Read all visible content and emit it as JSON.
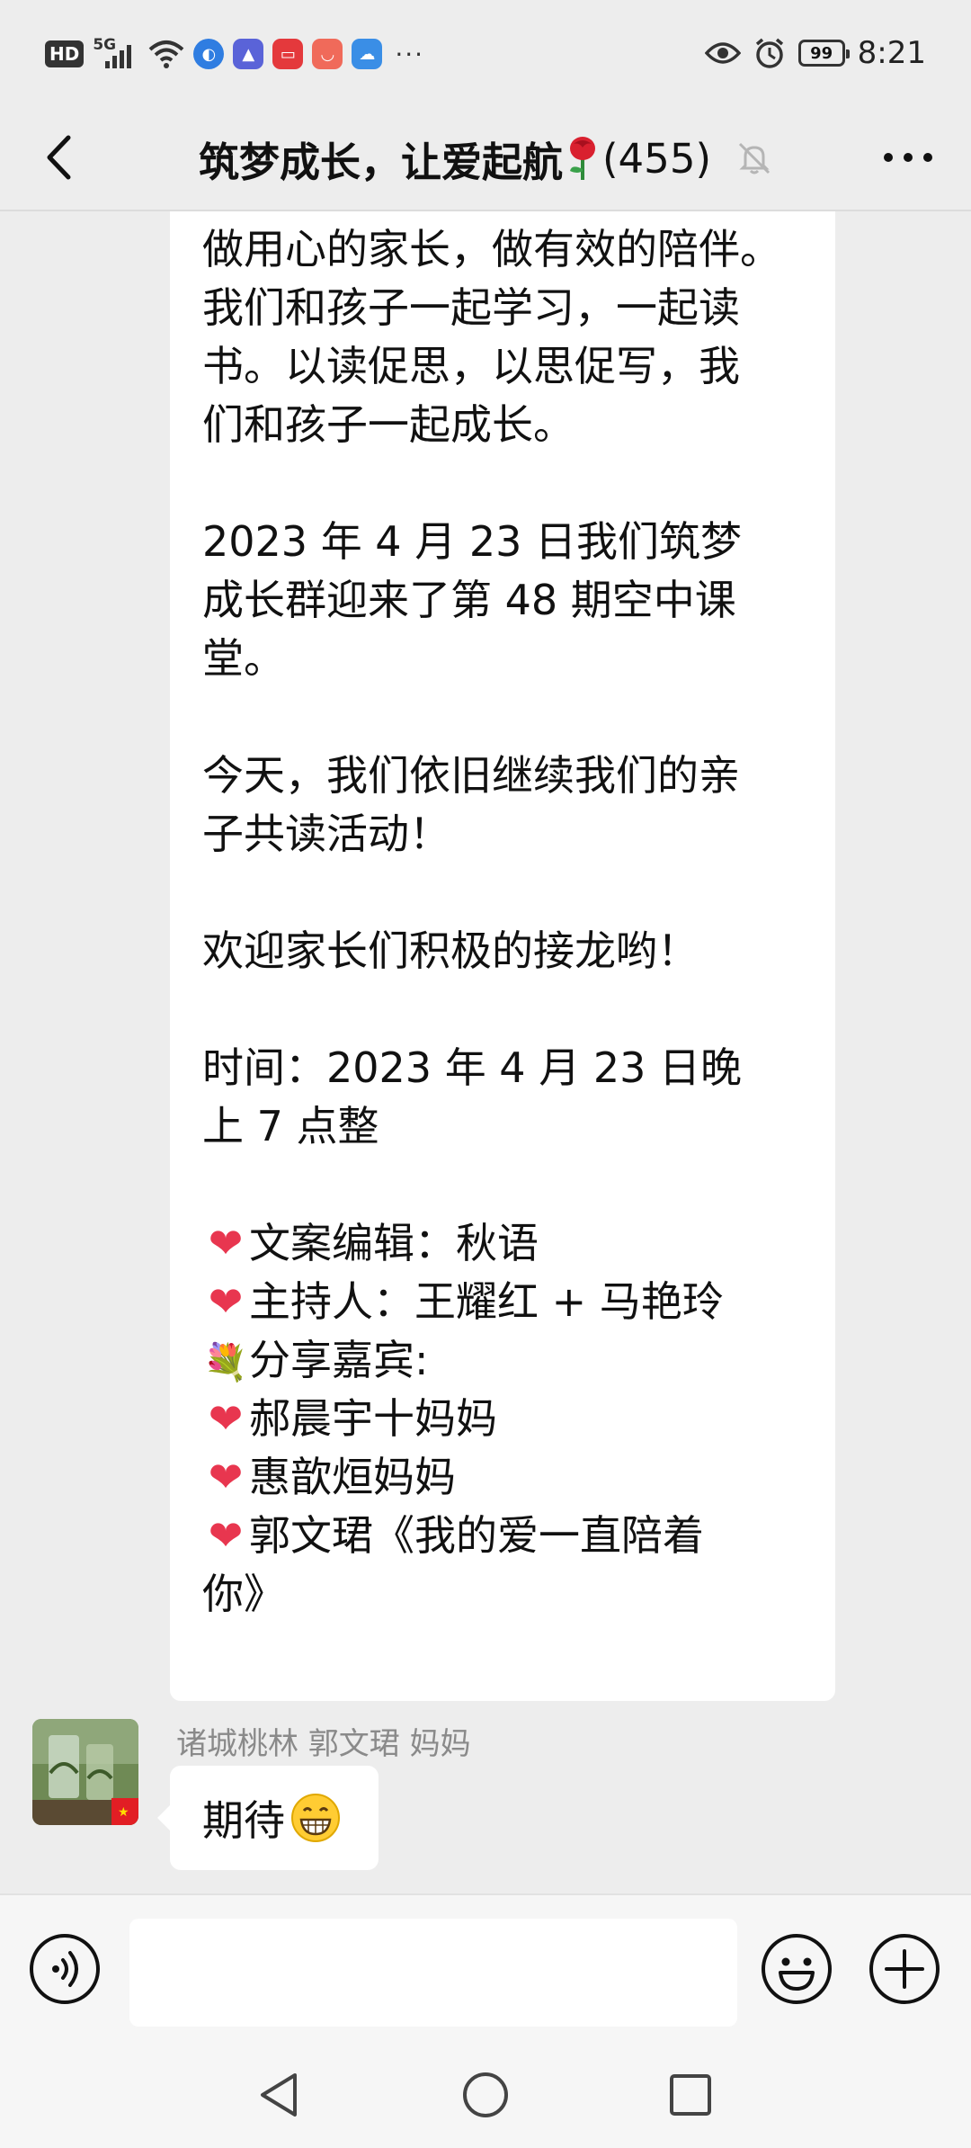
{
  "status_bar": {
    "hd": "HD",
    "network": "5G",
    "battery": "99",
    "time": "8:21",
    "icons": [
      "hd-icon",
      "signal-icon",
      "wifi-icon",
      "app-icon-globe",
      "app-icon-edu",
      "app-icon-red",
      "app-icon-bag",
      "app-icon-cloud",
      "more-dots-icon",
      "eye-icon",
      "alarm-icon",
      "battery-icon"
    ]
  },
  "header": {
    "title": "筑梦成长，让爱起航",
    "count": "(455)",
    "icons": [
      "back-icon",
      "rose-icon",
      "mute-bell-icon",
      "more-icon"
    ]
  },
  "messages": [
    {
      "type": "text",
      "lines": [
        "做用心的家长，做有效的陪伴。",
        "我们和孩子一起学习，一起读",
        "书。以读促思，以思促写，我",
        "们和孩子一起成长。",
        "",
        "2023 年 4 月 23 日我们筑梦",
        "成长群迎来了第 48 期空中课",
        "堂。",
        "",
        "今天，我们依旧继续我们的亲",
        "子共读活动！",
        "",
        "欢迎家长们积极的接龙哟！",
        "",
        "时间：2023 年 4 月 23 日晚",
        "上 7 点整",
        ""
      ],
      "list": [
        {
          "icon": "heart-icon",
          "text": "文案编辑：秋语"
        },
        {
          "icon": "heart-icon",
          "text": "主持人：王耀红 + 马艳玲"
        },
        {
          "icon": "bouquet-icon",
          "text": "分享嘉宾:"
        },
        {
          "icon": "heart-icon",
          "text": "郝晨宇十妈妈"
        },
        {
          "icon": "heart-icon",
          "text": "惠歆烜妈妈"
        },
        {
          "icon": "heart-icon",
          "text": "郭文珺《我的爱一直陪着"
        }
      ],
      "last_line": "你》"
    },
    {
      "type": "text",
      "sender": "诸城桃林 郭文珺 妈妈",
      "text": "期待",
      "emoji": "grinning-face-icon"
    }
  ],
  "input_bar": {
    "placeholder": "",
    "icons": [
      "voice-icon",
      "emoji-icon",
      "plus-icon"
    ]
  },
  "nav_bar": {
    "icons": [
      "nav-back-icon",
      "nav-home-icon",
      "nav-recent-icon"
    ]
  },
  "colors": {
    "background": "#ededed",
    "bubble": "#ffffff",
    "heart": "#e8364f",
    "sender_name": "#8a8a8a"
  }
}
